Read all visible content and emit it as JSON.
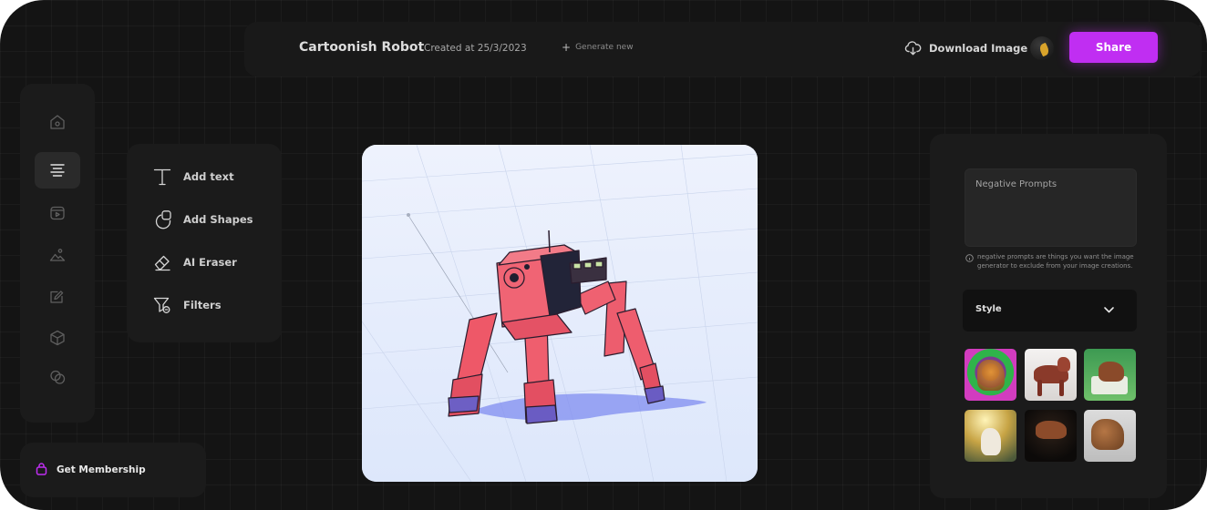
{
  "header": {
    "title": "Cartoonish Robot",
    "created": "Created at 25/3/2023",
    "generate_new": "Generate new",
    "download": "Download Image",
    "share": "Share"
  },
  "rail": {
    "icons": [
      "home-icon",
      "text-align-icon",
      "media-icon",
      "image-icon",
      "edit-icon",
      "cube-icon",
      "shapes-icon"
    ],
    "active": "text-align-icon"
  },
  "tools": [
    {
      "label": "Add text",
      "icon": "text-icon"
    },
    {
      "label": "Add Shapes",
      "icon": "shapes-icon"
    },
    {
      "label": "AI Eraser",
      "icon": "eraser-icon"
    },
    {
      "label": "Filters",
      "icon": "filter-icon"
    }
  ],
  "membership": {
    "label": "Get Membership"
  },
  "settings": {
    "negative_prompts_placeholder": "Negative Prompts",
    "hint": "negative prompts are things you want the image generator to exclude from your image creations.",
    "style_label": "Style"
  },
  "colors": {
    "accent": "#c02ef2",
    "background": "#141414",
    "panel": "#1b1b1b",
    "canvas_bg": "#e4ecfb",
    "robot": "#ef5c6c"
  }
}
